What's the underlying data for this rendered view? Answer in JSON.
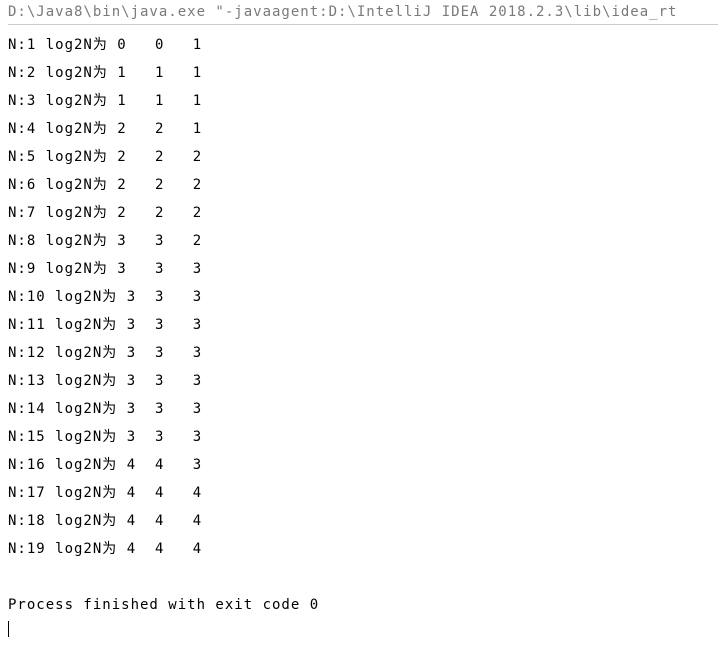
{
  "console": {
    "command": "D:\\Java8\\bin\\java.exe \"-javaagent:D:\\IntelliJ IDEA 2018.2.3\\lib\\idea_rt",
    "rows": [
      {
        "n": "1",
        "log": "0",
        "c1": "0",
        "c2": "1"
      },
      {
        "n": "2",
        "log": "1",
        "c1": "1",
        "c2": "1"
      },
      {
        "n": "3",
        "log": "1",
        "c1": "1",
        "c2": "1"
      },
      {
        "n": "4",
        "log": "2",
        "c1": "2",
        "c2": "1"
      },
      {
        "n": "5",
        "log": "2",
        "c1": "2",
        "c2": "2"
      },
      {
        "n": "6",
        "log": "2",
        "c1": "2",
        "c2": "2"
      },
      {
        "n": "7",
        "log": "2",
        "c1": "2",
        "c2": "2"
      },
      {
        "n": "8",
        "log": "3",
        "c1": "3",
        "c2": "2"
      },
      {
        "n": "9",
        "log": "3",
        "c1": "3",
        "c2": "3"
      },
      {
        "n": "10",
        "log": "3",
        "c1": "3",
        "c2": "3"
      },
      {
        "n": "11",
        "log": "3",
        "c1": "3",
        "c2": "3"
      },
      {
        "n": "12",
        "log": "3",
        "c1": "3",
        "c2": "3"
      },
      {
        "n": "13",
        "log": "3",
        "c1": "3",
        "c2": "3"
      },
      {
        "n": "14",
        "log": "3",
        "c1": "3",
        "c2": "3"
      },
      {
        "n": "15",
        "log": "3",
        "c1": "3",
        "c2": "3"
      },
      {
        "n": "16",
        "log": "4",
        "c1": "4",
        "c2": "3"
      },
      {
        "n": "17",
        "log": "4",
        "c1": "4",
        "c2": "4"
      },
      {
        "n": "18",
        "log": "4",
        "c1": "4",
        "c2": "4"
      },
      {
        "n": "19",
        "log": "4",
        "c1": "4",
        "c2": "4"
      }
    ],
    "labels": {
      "prefix_n": "N:",
      "prefix_log": " log2N为 "
    },
    "process_message": "Process finished with exit code 0"
  }
}
